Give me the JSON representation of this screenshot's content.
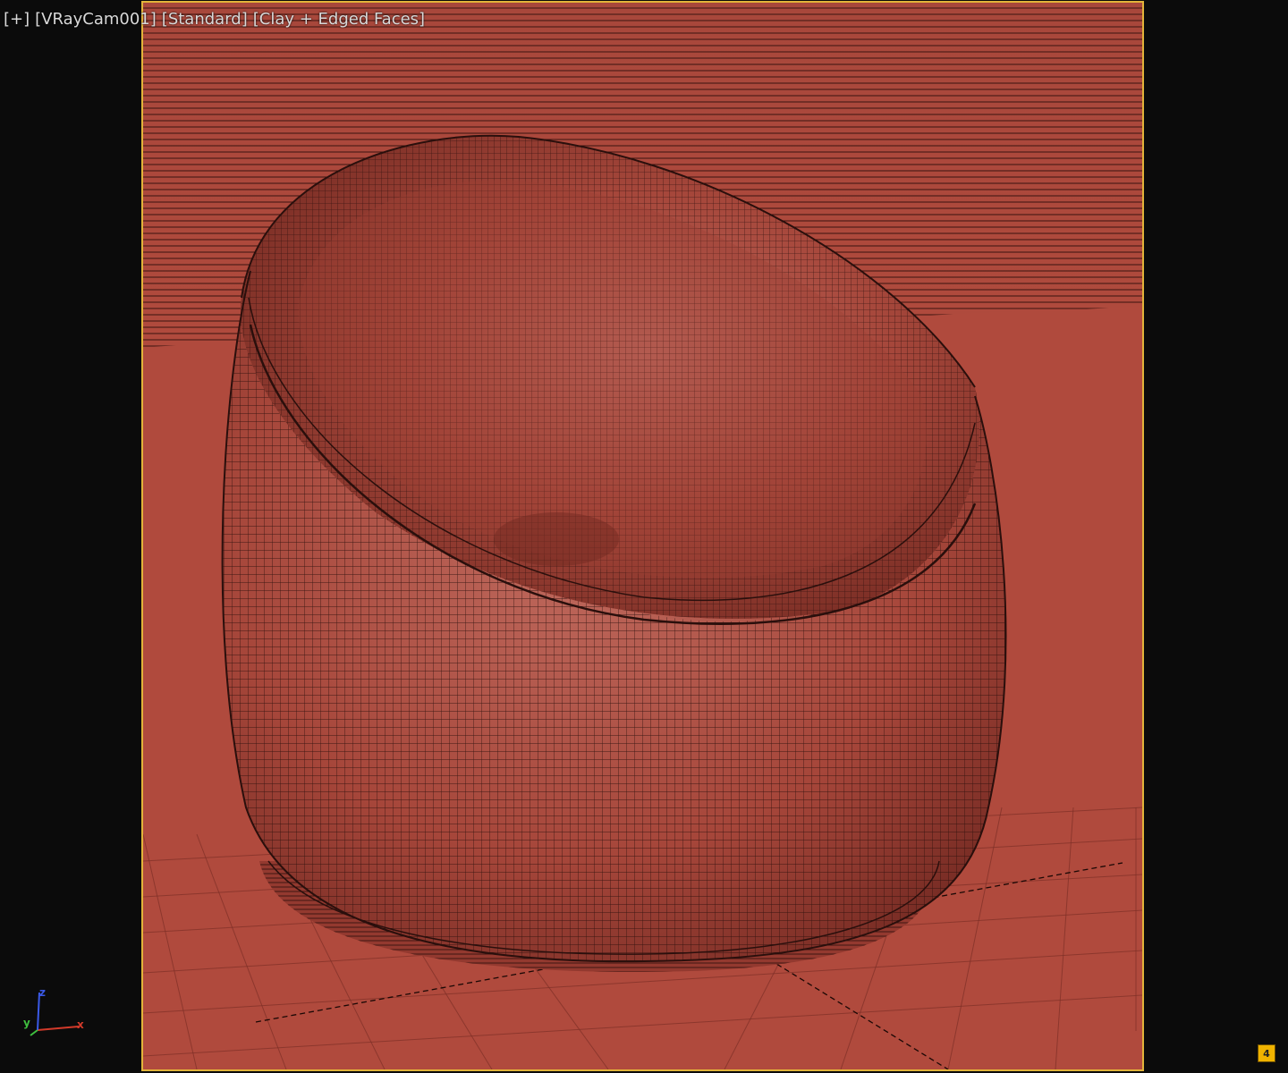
{
  "viewport": {
    "label": {
      "menu": "[+]",
      "camera": "[VRayCam001]",
      "view_mode": "[Standard]",
      "shading": "[Clay + Edged Faces]"
    }
  },
  "axis_tripod": {
    "x_label": "x",
    "y_label": "y",
    "z_label": "z",
    "x_color": "#d23a2a",
    "y_color": "#3fbf3f",
    "z_color": "#3a59e6"
  },
  "corner_badge": {
    "icon": "maximize-icon",
    "text": "4"
  },
  "colors": {
    "background": "#0b0b0b",
    "safe_frame": "#e2b33a",
    "clay": "#b24a3d",
    "clay_dark": "#8f3a30",
    "wire": "#2a0f0c",
    "label_text": "#d9d9d9"
  }
}
